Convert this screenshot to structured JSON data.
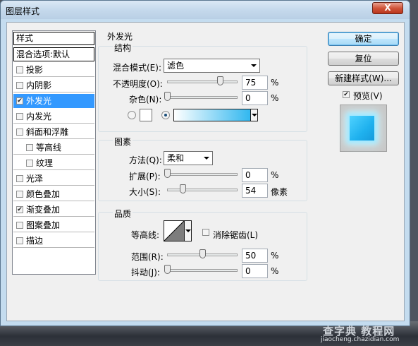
{
  "window": {
    "title": "图层样式",
    "close_glyph": "X"
  },
  "styles_list": {
    "header": "样式",
    "blend_default": "混合选项:默认",
    "items": [
      {
        "label": "投影",
        "checked": false
      },
      {
        "label": "内阴影",
        "checked": false
      },
      {
        "label": "外发光",
        "checked": true,
        "selected": true
      },
      {
        "label": "内发光",
        "checked": false
      },
      {
        "label": "斜面和浮雕",
        "checked": false
      },
      {
        "label": "等高线",
        "checked": false,
        "indented": true
      },
      {
        "label": "纹理",
        "checked": false,
        "indented": true
      },
      {
        "label": "光泽",
        "checked": false
      },
      {
        "label": "颜色叠加",
        "checked": false
      },
      {
        "label": "渐变叠加",
        "checked": true
      },
      {
        "label": "图案叠加",
        "checked": false
      },
      {
        "label": "描边",
        "checked": false
      }
    ]
  },
  "outer_glow": {
    "title": "外发光",
    "structure": {
      "title": "结构",
      "blend_mode_label": "混合模式(E):",
      "blend_mode_value": "滤色",
      "opacity_label": "不透明度(O):",
      "opacity_value": "75",
      "opacity_fraction": 0.75,
      "noise_label": "杂色(N):",
      "noise_value": "0",
      "noise_fraction": 0,
      "unit_percent": "%",
      "color_mode": "gradient"
    },
    "elements": {
      "title": "图素",
      "technique_label": "方法(Q):",
      "technique_value": "柔和",
      "spread_label": "扩展(P):",
      "spread_value": "0",
      "spread_fraction": 0,
      "size_label": "大小(S):",
      "size_value": "54",
      "size_fraction": 0.22,
      "unit_percent": "%",
      "unit_pixels": "像素"
    },
    "quality": {
      "title": "品质",
      "contour_label": "等高线:",
      "anti_alias_label": "消除锯齿(L)",
      "anti_alias_checked": false,
      "range_label": "范围(R):",
      "range_value": "50",
      "range_fraction": 0.5,
      "jitter_label": "抖动(J):",
      "jitter_value": "0",
      "jitter_fraction": 0,
      "unit_percent": "%"
    }
  },
  "buttons": {
    "ok": "确定",
    "reset": "复位",
    "new_style": "新建样式(W)...",
    "preview_label": "预览(V)",
    "preview_checked": true
  },
  "colors": {
    "glow_gradient_start": "#ffffff",
    "glow_gradient_end": "#1fb1ee",
    "selection": "#3399ff"
  },
  "watermark": {
    "logo": "查字典 教程网",
    "url": "jiaocheng.chazidian.com"
  }
}
